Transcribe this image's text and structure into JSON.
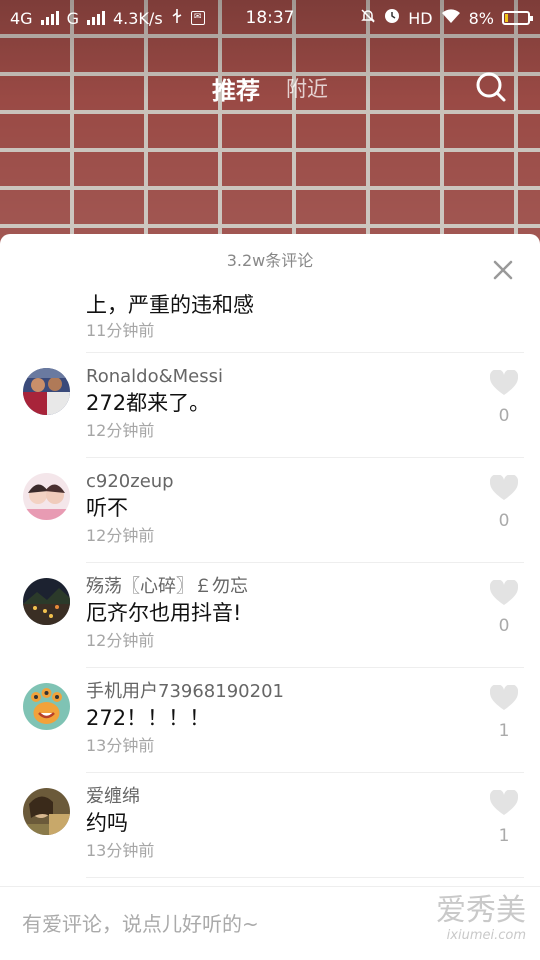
{
  "status_bar": {
    "network1": "4G",
    "network2": "G",
    "speed": "4.3K/s",
    "time": "18:37",
    "hd": "HD",
    "battery": "8%"
  },
  "top_nav": {
    "tab_recommend": "推荐",
    "tab_nearby": "附近"
  },
  "comments_panel": {
    "title": "3.2w条评论",
    "partial_comment": {
      "text": "上，严重的违和感",
      "time": "11分钟前"
    },
    "comments": [
      {
        "name": "Ronaldo&Messi",
        "text": "272都来了。",
        "time": "12分钟前",
        "likes": "0"
      },
      {
        "name": "c920zeup",
        "text": "听不",
        "time": "12分钟前",
        "likes": "0"
      },
      {
        "name": "殇荡〖心碎〗￡勿忘",
        "text": "厄齐尔也用抖音!",
        "time": "12分钟前",
        "likes": "0"
      },
      {
        "name": "手机用户73968190201",
        "text": "272！！！！",
        "time": "13分钟前",
        "likes": "1"
      },
      {
        "name": "爱缠绵",
        "text": "约吗",
        "time": "13分钟前",
        "likes": "1"
      }
    ]
  },
  "input": {
    "placeholder": "有爱评论，说点儿好听的~"
  },
  "watermark": {
    "main": "爱秀美",
    "sub": "ixiumei.com"
  },
  "colors": {
    "brick": "#9a4a45",
    "mortar": "#c9c2bb",
    "secondary_text": "#888888"
  }
}
